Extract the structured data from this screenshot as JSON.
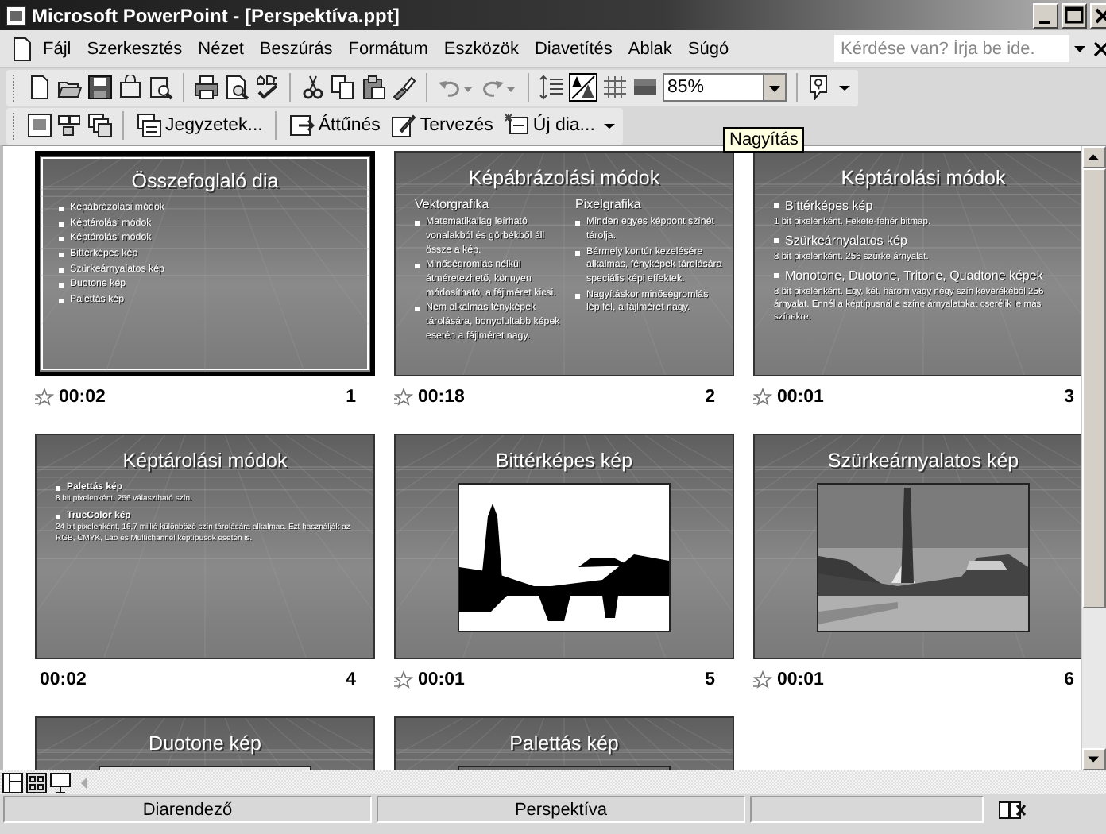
{
  "window": {
    "title": "Microsoft PowerPoint - [Perspektíva.ppt]"
  },
  "menu": [
    "Fájl",
    "Szerkesztés",
    "Nézet",
    "Beszúrás",
    "Formátum",
    "Eszközök",
    "Diavetítés",
    "Ablak",
    "Súgó"
  ],
  "help_box": {
    "placeholder": "Kérdése van? Írja be ide."
  },
  "toolbar": {
    "zoom": "85%",
    "tooltip": "Nagyítás"
  },
  "toolbar_2": [
    "Jegyzetek...",
    "Áttűnés",
    "Tervezés",
    "Új dia..."
  ],
  "slides": [
    {
      "number": "1",
      "time": "00:02",
      "effect": true,
      "selected": true,
      "kind": "bullets",
      "title": "Összefoglaló dia",
      "bullets": [
        "Képábrázolási módok",
        "Képtárolási módok",
        "Képtárolási módok",
        "Bittérképes kép",
        "Szürkeárnyalatos kép",
        "Duotone kép",
        "Palettás kép"
      ]
    },
    {
      "number": "2",
      "time": "00:18",
      "effect": true,
      "selected": false,
      "kind": "columns",
      "title": "Képábrázolási módok",
      "columns": [
        {
          "heading": "Vektorgrafika",
          "bullets": [
            "Matematikailag leírható vonalakból és görbékből áll össze a kép.",
            "Minőségromlás nélkül átméretezhető, könnyen módosítható, a fájlméret kicsi.",
            "Nem alkalmas fényképek tárolására, bonyolultabb képek esetén a fájlméret nagy."
          ]
        },
        {
          "heading": "Pixelgrafika",
          "bullets": [
            "Minden egyes képpont színét tárolja.",
            "Bármely kontúr kezelésére alkalmas, fényképek tárolására speciális képi effektek.",
            "Nagyításkor minőségromlás lép fel, a fájlméret nagy."
          ]
        }
      ]
    },
    {
      "number": "3",
      "time": "00:01",
      "effect": true,
      "selected": false,
      "kind": "detailed",
      "title": "Képtárolási módok",
      "items": [
        {
          "text": "Bittérképes kép",
          "detail": "1 bit pixelenként. Fekete-fehér bitmap."
        },
        {
          "text": "Szürkeárnyalatos kép",
          "detail": "8 bit pixelenként. 256 szürke árnyalat."
        },
        {
          "text": "Monotone, Duotone, Tritone, Quadtone képek",
          "detail": "8 bit pixelenként. Egy, két, három vagy négy szín keverékéből 256 árnyalat. Ennél a képtípusnál a színe árnyalatokat cserélik le más színekre."
        }
      ]
    },
    {
      "number": "4",
      "time": "00:02",
      "effect": false,
      "selected": false,
      "kind": "small",
      "title": "Képtárolási módok",
      "items": [
        {
          "text": "Palettás kép",
          "detail": "8 bit pixelenként. 256 választható szín."
        },
        {
          "text": "TrueColor kép",
          "detail": "24 bit pixelenként, 16,7 millió különböző szín tárolására alkalmas. Ezt használják az RGB, CMYK, Lab és Multichannel képtípusok esetén is."
        }
      ]
    },
    {
      "number": "5",
      "time": "00:01",
      "effect": true,
      "selected": false,
      "kind": "picture",
      "title": "Bittérképes kép"
    },
    {
      "number": "6",
      "time": "00:01",
      "effect": true,
      "selected": false,
      "kind": "picture",
      "title": "Szürkeárnyalatos kép"
    },
    {
      "selected": false,
      "kind": "picture",
      "title": "Duotone kép"
    },
    {
      "selected": false,
      "kind": "picture",
      "title": "Palettás kép"
    }
  ],
  "status_bar": [
    "Diarendező",
    "Perspektíva"
  ]
}
